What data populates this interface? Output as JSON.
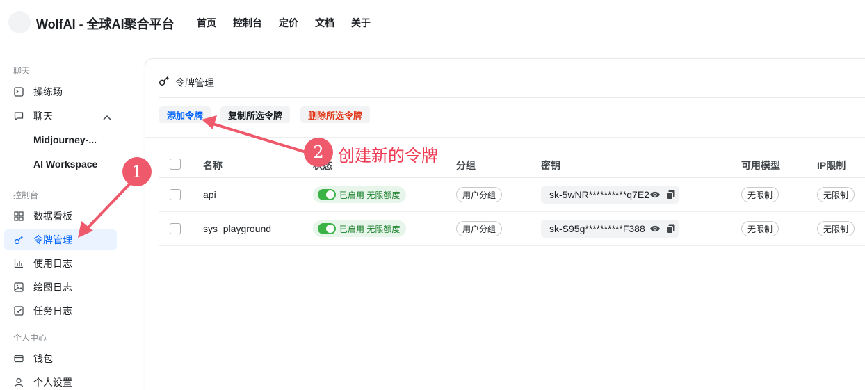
{
  "header": {
    "brand": "WolfAI - 全球AI聚合平台",
    "nav": [
      "首页",
      "控制台",
      "定价",
      "文档",
      "关于"
    ]
  },
  "sidebar": {
    "group_chat": "聊天",
    "playground": "操练场",
    "chat": "聊天",
    "midjourney": "Midjourney-...",
    "ai_workspace": "AI Workspace",
    "group_console": "控制台",
    "dashboard": "数据看板",
    "token_mgmt": "令牌管理",
    "usage_log": "使用日志",
    "draw_log": "绘图日志",
    "task_log": "任务日志",
    "group_personal": "个人中心",
    "wallet": "钱包",
    "settings": "个人设置"
  },
  "page": {
    "title": "令牌管理",
    "add_button": "添加令牌",
    "copy_button": "复制所选令牌",
    "delete_button": "删除所选令牌"
  },
  "table": {
    "headers": [
      "名称",
      "状态",
      "分组",
      "密钥",
      "可用模型",
      "IP限制"
    ],
    "rows": [
      {
        "name": "api",
        "status": "已启用 无限额度",
        "group": "用户分组",
        "key": "sk-5wNR**********q7E2",
        "models": "无限制",
        "ip": "无限制"
      },
      {
        "name": "sys_playground",
        "status": "已启用 无限额度",
        "group": "用户分组",
        "key": "sk-S95g**********F388",
        "models": "无限制",
        "ip": "无限制"
      }
    ]
  },
  "annotations": {
    "marker1": "1",
    "marker2": "2",
    "caption": "创建新的令牌"
  },
  "colors": {
    "accent": "#0064fa",
    "danger": "#e03b1c",
    "enabled": "#3bb346",
    "annotation": "#ee5a6b"
  }
}
